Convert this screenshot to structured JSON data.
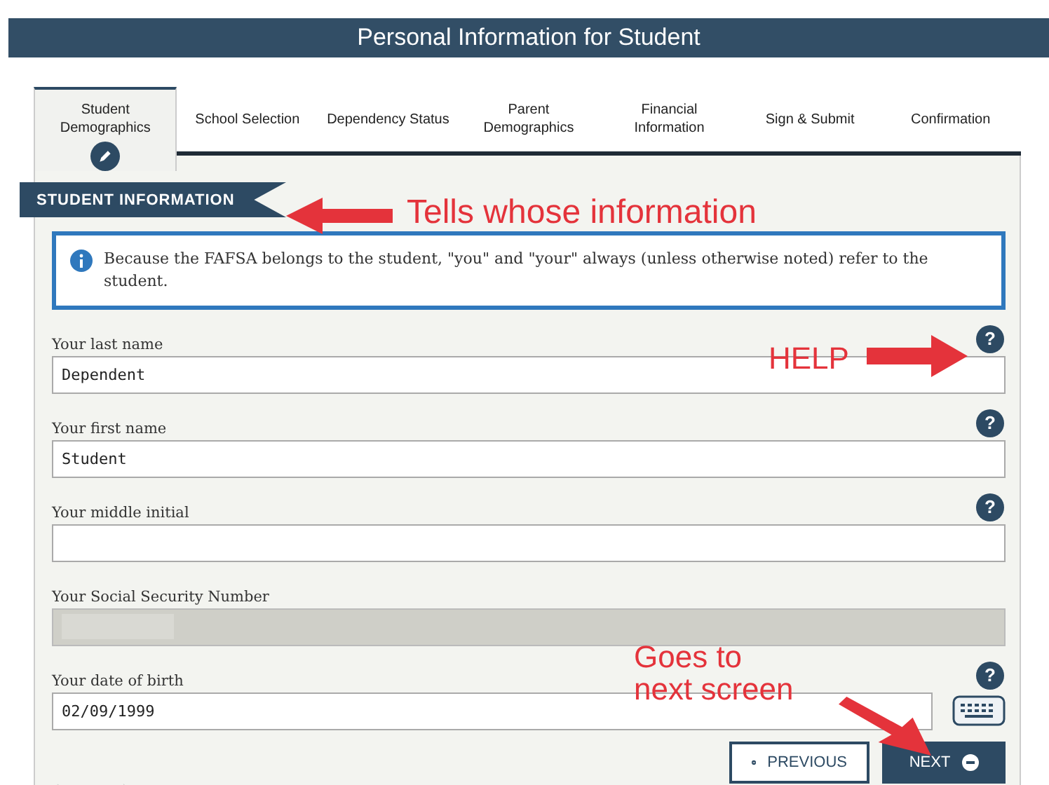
{
  "window": {
    "title": "Personal Information for Student"
  },
  "tabs": [
    {
      "label": "Student Demographics",
      "selected": true
    },
    {
      "label": "School Selection",
      "selected": false
    },
    {
      "label": "Dependency Status",
      "selected": false
    },
    {
      "label": "Parent Demographics",
      "selected": false
    },
    {
      "label": "Financial Information",
      "selected": false
    },
    {
      "label": "Sign & Submit",
      "selected": false
    },
    {
      "label": "Confirmation",
      "selected": false
    }
  ],
  "section": {
    "title": "STUDENT INFORMATION"
  },
  "notice": {
    "text": "Because the FAFSA belongs to the student, \"you\" and \"your\" always (unless otherwise noted) refer to the student."
  },
  "fields": [
    {
      "label": "Your last name",
      "value": "Dependent",
      "disabled": false,
      "kind": "text",
      "help": "?"
    },
    {
      "label": "Your first name",
      "value": "Student",
      "disabled": false,
      "kind": "text",
      "help": "?"
    },
    {
      "label": "Your middle initial",
      "disabled": false,
      "kind": "text",
      "help": "?"
    },
    {
      "label": "Your Social Security Number",
      "disabled": true,
      "kind": "masked"
    },
    {
      "label": "Your date of birth",
      "value": "02/09/1999",
      "disabled": false,
      "kind": "date",
      "help": "?"
    }
  ],
  "buttons": [
    {
      "label": "PREVIOUS",
      "kind": "previous"
    },
    {
      "label": "NEXT",
      "kind": "next"
    }
  ],
  "annotations": [
    {
      "text": "Tells whose information",
      "kind": "section"
    },
    {
      "text": "HELP",
      "kind": "help"
    },
    {
      "text": "Goes to next screen",
      "kind": "next"
    }
  ]
}
